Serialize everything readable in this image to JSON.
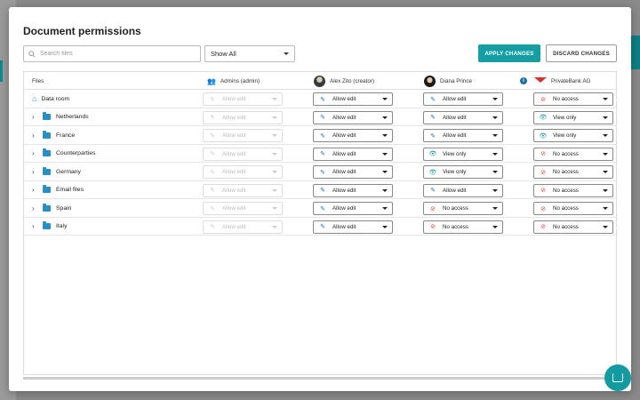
{
  "modal": {
    "title": "Document permissions",
    "search_placeholder": "Search files",
    "filter_value": "Show All",
    "apply_label": "APPLY CHANGES",
    "discard_label": "DISCARD CHANGES"
  },
  "columns": [
    "Files",
    "Admins (admin)",
    "Alex Zito (creator)",
    "Diana Prince",
    "PrivateBank AG"
  ],
  "rows": [
    {
      "name": "Data room",
      "perms": [
        "Allow edit",
        "Allow edit",
        "Allow edit",
        "No access"
      ]
    },
    {
      "name": "Netherlands",
      "perms": [
        "Allow edit",
        "Allow edit",
        "Allow edit",
        "View only"
      ]
    },
    {
      "name": "France",
      "perms": [
        "Allow edit",
        "Allow edit",
        "Allow edit",
        "View only"
      ]
    },
    {
      "name": "Counterparties",
      "perms": [
        "Allow edit",
        "Allow edit",
        "View only",
        "No access"
      ]
    },
    {
      "name": "Germany",
      "perms": [
        "Allow edit",
        "Allow edit",
        "View only",
        "No access"
      ]
    },
    {
      "name": "Email files",
      "perms": [
        "Allow edit",
        "Allow edit",
        "Allow edit",
        "No access"
      ]
    },
    {
      "name": "Spain",
      "perms": [
        "Allow edit",
        "Allow edit",
        "No access",
        "No access"
      ]
    },
    {
      "name": "Italy",
      "perms": [
        "Allow edit",
        "Allow edit",
        "No access",
        "No access"
      ]
    }
  ],
  "icons": {
    "Allow edit": "pencil-icon",
    "View only": "eye-icon",
    "No access": "no-access-icon"
  },
  "colors": {
    "accent": "#159ea4",
    "folder": "#2a8ec6"
  }
}
